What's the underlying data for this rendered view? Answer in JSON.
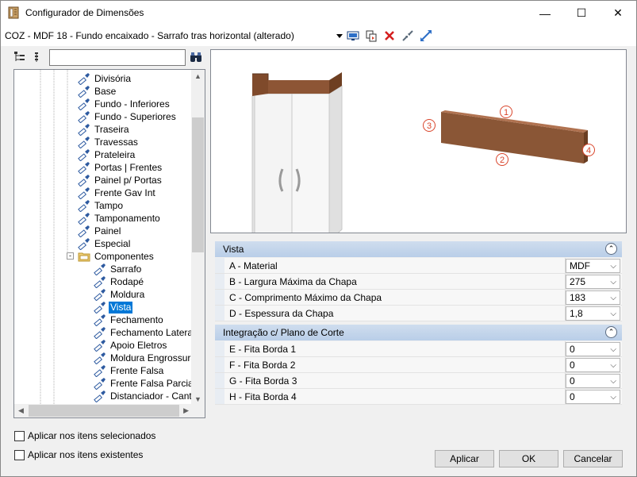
{
  "window": {
    "title": "Configurador de Dimensões",
    "minimize": "—",
    "maximize": "☐",
    "close": "✕"
  },
  "toolbar": {
    "item_title": "COZ - MDF 18 - Fundo encaixado - Sarrafo tras horizontal (alterado)",
    "icons": [
      "dropdown-arrow-icon",
      "monitor-icon",
      "copy-icon",
      "delete-x-icon",
      "collapse-arrows-icon",
      "expand-arrows-icon"
    ]
  },
  "search": {
    "value": ""
  },
  "tree": {
    "items": [
      {
        "label": "Divisória",
        "level": 1
      },
      {
        "label": "Base",
        "level": 1
      },
      {
        "label": "Fundo - Inferiores",
        "level": 1
      },
      {
        "label": "Fundo - Superiores",
        "level": 1
      },
      {
        "label": "Traseira",
        "level": 1
      },
      {
        "label": "Travessas",
        "level": 1
      },
      {
        "label": "Prateleira",
        "level": 1
      },
      {
        "label": "Portas | Frentes",
        "level": 1
      },
      {
        "label": "Painel p/ Portas",
        "level": 1
      },
      {
        "label": "Frente Gav Int",
        "level": 1
      },
      {
        "label": "Tampo",
        "level": 1
      },
      {
        "label": "Tamponamento",
        "level": 1
      },
      {
        "label": "Painel",
        "level": 1
      },
      {
        "label": "Especial",
        "level": 1
      },
      {
        "label": "Componentes",
        "level": 1,
        "folder": true
      },
      {
        "label": "Sarrafo",
        "level": 2
      },
      {
        "label": "Rodapé",
        "level": 2
      },
      {
        "label": "Moldura",
        "level": 2
      },
      {
        "label": "Vista",
        "level": 2,
        "selected": true
      },
      {
        "label": "Fechamento",
        "level": 2
      },
      {
        "label": "Fechamento Lateral",
        "level": 2
      },
      {
        "label": "Apoio Eletros",
        "level": 2
      },
      {
        "label": "Moldura Engrossuram",
        "level": 2
      },
      {
        "label": "Frente Falsa",
        "level": 2
      },
      {
        "label": "Frente Falsa Parcial",
        "level": 2
      },
      {
        "label": "Distanciador - Canto",
        "level": 2
      }
    ]
  },
  "preview": {
    "edge_labels": [
      "1",
      "2",
      "3",
      "4"
    ]
  },
  "properties": {
    "vista": {
      "title": "Vista",
      "rows": [
        {
          "name": "A - Material",
          "value": "MDF"
        },
        {
          "name": "B - Largura Máxima da Chapa",
          "value": "275"
        },
        {
          "name": "C - Comprimento Máximo da Chapa",
          "value": "183"
        },
        {
          "name": "D - Espessura da Chapa",
          "value": "1,8"
        }
      ]
    },
    "integracao": {
      "title": "Integração c/ Plano de Corte",
      "rows": [
        {
          "name": "E - Fita Borda 1",
          "value": "0"
        },
        {
          "name": "F - Fita Borda 2",
          "value": "0"
        },
        {
          "name": "G - Fita Borda 3",
          "value": "0"
        },
        {
          "name": "H - Fita Borda 4",
          "value": "0"
        }
      ]
    }
  },
  "options": {
    "apply_selected": "Aplicar nos itens selecionados",
    "apply_existing": "Aplicar nos itens existentes"
  },
  "buttons": {
    "apply": "Aplicar",
    "ok": "OK",
    "cancel": "Cancelar"
  },
  "colors": {
    "selection": "#0078d7",
    "wood": "#8a5636",
    "edge_marker": "#d9452b",
    "category_header": "#c6d7ec"
  }
}
